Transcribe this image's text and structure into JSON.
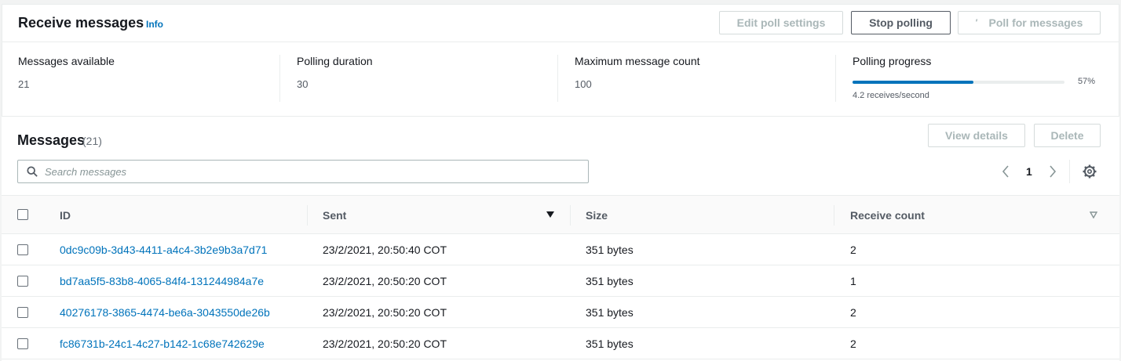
{
  "receive": {
    "title": "Receive messages",
    "info_label": "Info",
    "buttons": {
      "edit_poll": "Edit poll settings",
      "stop_polling": "Stop polling",
      "poll_for_messages": "Poll for messages"
    },
    "stats": {
      "messages_available": {
        "label": "Messages available",
        "value": "21"
      },
      "polling_duration": {
        "label": "Polling duration",
        "value": "30"
      },
      "max_message_count": {
        "label": "Maximum message count",
        "value": "100"
      },
      "polling_progress": {
        "label": "Polling progress",
        "percent_text": "57%",
        "percent": 57,
        "rate": "4.2 receives/second"
      }
    }
  },
  "messages": {
    "title": "Messages",
    "count": "(21)",
    "buttons": {
      "view_details": "View details",
      "delete": "Delete"
    },
    "search": {
      "placeholder": "Search messages",
      "value": ""
    },
    "pager": {
      "current_page": "1"
    },
    "columns": {
      "id": "ID",
      "sent": "Sent",
      "size": "Size",
      "receive_count": "Receive count"
    },
    "rows": [
      {
        "id": "0dc9c09b-3d43-4411-a4c4-3b2e9b3a7d71",
        "sent": "23/2/2021, 20:50:40 COT",
        "size": "351 bytes",
        "receive_count": "2"
      },
      {
        "id": "bd7aa5f5-83b8-4065-84f4-131244984a7e",
        "sent": "23/2/2021, 20:50:20 COT",
        "size": "351 bytes",
        "receive_count": "1"
      },
      {
        "id": "40276178-3865-4474-be6a-3043550de26b",
        "sent": "23/2/2021, 20:50:20 COT",
        "size": "351 bytes",
        "receive_count": "2"
      },
      {
        "id": "fc86731b-24c1-4c27-b142-1c68e742629e",
        "sent": "23/2/2021, 20:50:20 COT",
        "size": "351 bytes",
        "receive_count": "2"
      }
    ]
  },
  "colors": {
    "link": "#0073bb",
    "progress": "#0073bb",
    "border": "#eaeded",
    "disabled_text": "#aab7b8"
  },
  "icons": [
    "search-icon",
    "chevron-left-icon",
    "chevron-right-icon",
    "gear-icon",
    "sort-descending-icon",
    "sort-icon",
    "spinner-icon"
  ]
}
